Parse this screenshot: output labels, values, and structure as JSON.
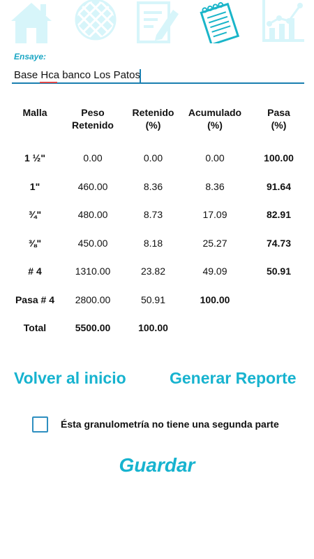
{
  "nav": {
    "icons": [
      "home-icon",
      "sieve-icon",
      "edit-document-icon",
      "notebook-icon",
      "chart-icon"
    ],
    "colors": {
      "inactive": "#d7f5fa",
      "active": "#1ab5c9"
    }
  },
  "ensaye": {
    "label": "Ensaye:",
    "value": "Base Hca banco Los Patos"
  },
  "table": {
    "headers": {
      "malla": "Malla",
      "peso_1": "Peso",
      "peso_2": "Retenido",
      "ret_1": "Retenido",
      "ret_2": "(%)",
      "acum_1": "Acumulado",
      "acum_2": "(%)",
      "pasa_1": "Pasa",
      "pasa_2": "(%)"
    },
    "rows": [
      {
        "malla": "1 ½\"",
        "peso": "0.00",
        "retenido": "0.00",
        "acumulado": "0.00",
        "pasa": "100.00"
      },
      {
        "malla": "1\"",
        "peso": "460.00",
        "retenido": "8.36",
        "acumulado": "8.36",
        "pasa": "91.64"
      },
      {
        "malla": "¾\"",
        "peso": "480.00",
        "retenido": "8.73",
        "acumulado": "17.09",
        "pasa": "82.91"
      },
      {
        "malla": "⅜\"",
        "peso": "450.00",
        "retenido": "8.18",
        "acumulado": "25.27",
        "pasa": "74.73"
      },
      {
        "malla": "# 4",
        "peso": "1310.00",
        "retenido": "23.82",
        "acumulado": "49.09",
        "pasa": "50.91"
      },
      {
        "malla": "Pasa # 4",
        "peso": "2800.00",
        "retenido": "50.91",
        "acumulado": "100.00",
        "pasa": ""
      },
      {
        "malla": "Total",
        "peso": "5500.00",
        "retenido": "100.00",
        "acumulado": "",
        "pasa": ""
      }
    ]
  },
  "actions": {
    "volver": "Volver al inicio",
    "generar": "Generar Reporte",
    "checkbox_label": "Ésta granulometría no tiene una segunda parte",
    "guardar": "Guardar"
  }
}
